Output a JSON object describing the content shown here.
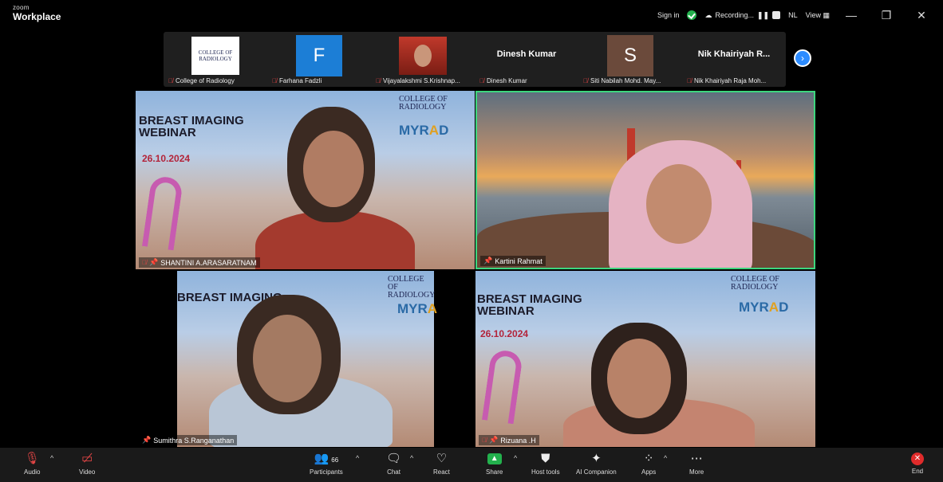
{
  "window": {
    "brand_small": "zoom",
    "brand_large": "Workplace",
    "sign_in": "Sign in",
    "recording": "Recording...",
    "view_initial": "NL",
    "view": "View",
    "minimize": "—",
    "restore": "❐",
    "close": "✕"
  },
  "strip": {
    "thumbnails": [
      {
        "display": "logo",
        "logo_text": "COLLEGE OF RADIOLOGY",
        "label": "College of Radiology",
        "muted": true
      },
      {
        "display": "letter",
        "letter": "F",
        "label": "Farhana Fadzli",
        "muted": true
      },
      {
        "display": "photo",
        "label": "Vijayalakshmi S.Krishnap...",
        "muted": true
      },
      {
        "display": "name",
        "name_text": "Dinesh Kumar",
        "label": "Dinesh Kumar",
        "muted": true
      },
      {
        "display": "letter",
        "letter": "S",
        "label": "Siti Nabilah Mohd. May...",
        "muted": true
      },
      {
        "display": "name",
        "name_text": "Nik Khairiyah R...",
        "label": "Nik Khairiyah Raja Moh...",
        "muted": true
      }
    ],
    "next_icon": "›"
  },
  "poster": {
    "title_line1": "BREAST IMAGING",
    "title_line2": "WEBINAR",
    "date": "26.10.2024",
    "college_line1": "COLLEGE OF",
    "college_line2": "RADIOLOGY",
    "myrad_prefix": "MYR",
    "myrad_accent": "A",
    "myrad_suffix": "D"
  },
  "videos": [
    {
      "name": "SHANTINI A.ARASARATNAM",
      "muted": true
    },
    {
      "name": "Kartini Rahmat",
      "muted": false,
      "active_speaker": true
    },
    {
      "name": "Sumithra S.Ranganathan",
      "muted": false
    },
    {
      "name": "Rizuana .H",
      "muted": true
    }
  ],
  "toolbar": {
    "audio": "Audio",
    "video": "Video",
    "participants": "Participants",
    "participants_count": "66",
    "chat": "Chat",
    "react": "React",
    "share": "Share",
    "host_tools": "Host tools",
    "ai_companion": "AI Companion",
    "apps": "Apps",
    "more": "More",
    "end": "End"
  },
  "colors": {
    "accent": "#2d8cff",
    "active_speaker_border": "#3dd67e",
    "muted_red": "#e24545",
    "share_green": "#23b14d",
    "end_red": "#e02b2b"
  }
}
